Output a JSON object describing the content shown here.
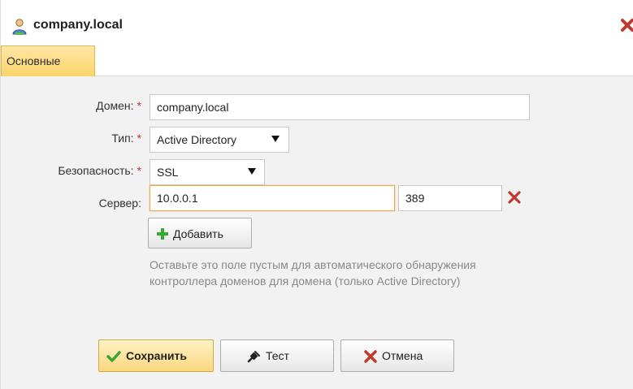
{
  "window": {
    "title": "company.local",
    "title_icon": "user-domain-icon",
    "close_icon": "close-icon"
  },
  "tabs": [
    {
      "label": "Основные",
      "active": true
    }
  ],
  "form": {
    "domain": {
      "label": "Домен:",
      "required_mark": "*",
      "value": "company.local"
    },
    "type": {
      "label": "Тип:",
      "required_mark": "*",
      "value": "Active Directory"
    },
    "security": {
      "label": "Безопасность:",
      "required_mark": "*",
      "value": "SSL"
    },
    "server": {
      "label": "Сервер:",
      "host": "10.0.0.1",
      "port": "389",
      "remove_icon": "remove-icon"
    },
    "add_button": {
      "label": "Добавить",
      "icon": "plus-icon"
    },
    "hint": "Оставьте это поле пустым для автоматического обнаружения контроллера доменов для домена (только Active Directory)"
  },
  "buttons": {
    "save": {
      "label": "Сохранить",
      "icon": "checkmark-icon"
    },
    "test": {
      "label": "Тест",
      "icon": "plug-icon"
    },
    "cancel": {
      "label": "Отмена",
      "icon": "cancel-icon"
    }
  },
  "colors": {
    "accent_tab": "#fbd46b",
    "required": "#c9302c",
    "remove": "#c0392b",
    "add_green": "#3aa63a",
    "save_check": "#3aa63a"
  }
}
